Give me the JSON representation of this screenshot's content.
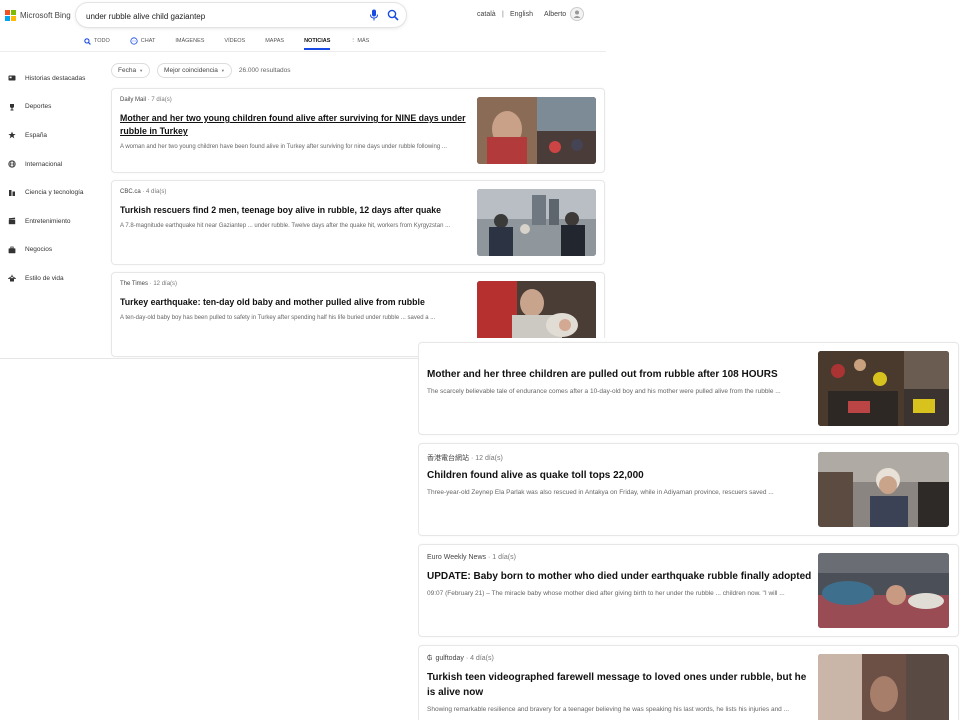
{
  "header": {
    "logo_text": "Microsoft Bing",
    "logo_colors": [
      "#f25022",
      "#7fba00",
      "#00a4ef",
      "#ffb900"
    ],
    "search_value": "under rubble alive child gaziantep",
    "lang_1": "català",
    "separator": "|",
    "lang_2": "English",
    "user_name": "Alberto"
  },
  "tabs": [
    {
      "label": "TODO",
      "icon": "search-icon",
      "active": false
    },
    {
      "label": "CHAT",
      "icon": "chat-icon",
      "active": false
    },
    {
      "label": "IMÁGENES",
      "icon": "",
      "active": false
    },
    {
      "label": "VÍDEOS",
      "icon": "",
      "active": false
    },
    {
      "label": "MAPAS",
      "icon": "",
      "active": false
    },
    {
      "label": "NOTICIAS",
      "icon": "",
      "active": true
    },
    {
      "label": "⋮ MÁS",
      "icon": "",
      "active": false
    }
  ],
  "sidebar": {
    "items": [
      {
        "label": "Historias destacadas",
        "icon": "newspaper-icon"
      },
      {
        "label": "Deportes",
        "icon": "trophy-icon"
      },
      {
        "label": "España",
        "icon": "star-icon"
      },
      {
        "label": "Internacional",
        "icon": "globe-icon"
      },
      {
        "label": "Ciencia y tecnología",
        "icon": "flask-icon"
      },
      {
        "label": "Entretenimiento",
        "icon": "clapper-icon"
      },
      {
        "label": "Negocios",
        "icon": "briefcase-icon"
      },
      {
        "label": "Estilo de vida",
        "icon": "hanger-icon"
      }
    ]
  },
  "filters": {
    "date_label": "Fecha",
    "sort_label": "Mejor coincidencia",
    "results_count": "26.000 resultados"
  },
  "results_top": [
    {
      "source": "Daily Mail",
      "age": " · 7 día(s)",
      "title": "Mother and her two young children found alive after surviving for NINE days under rubble in Turkey",
      "snippet": "A woman and her two young children have been found alive in Turkey after surviving for nine days under rubble following ..."
    },
    {
      "source": "CBC.ca",
      "age": " · 4 día(s)",
      "title": "Turkish rescuers find 2 men, teenage boy alive in rubble, 12 days after quake",
      "snippet": "A 7.8-magnitude earthquake hit near Gaziantep ... under rubble. Twelve days after the quake hit, workers from Kyrgyzstan ..."
    },
    {
      "source": "The Times",
      "age": " · 12 día(s)",
      "title": "Turkey earthquake: ten-day old baby and mother pulled alive from rubble",
      "snippet": "A ten-day-old baby boy has been pulled to safety in Turkey after spending half his life buried under rubble ... saved a ..."
    }
  ],
  "results_bottom": [
    {
      "source": "",
      "age": "",
      "title": "Mother and her three children are pulled out from rubble after 108 HOURS",
      "snippet": "The scarcely believable tale of endurance comes after a 10-day-old boy and his mother were pulled alive from the rubble ..."
    },
    {
      "source": "香港電台網站",
      "age": " · 12 día(s)",
      "title": "Children found alive as quake toll tops 22,000",
      "snippet": "Three-year-old Zeynep Ela Parlak was also rescued in Antakya on Friday, while in Adiyaman province, rescuers saved ..."
    },
    {
      "source": "Euro Weekly News",
      "age": " · 1 día(s)",
      "title": "UPDATE: Baby born to mother who died under earthquake rubble finally adopted",
      "snippet": "09:07 (February 21) – The miracle baby whose mother died after giving birth to her under the rubble ... children now. \"I will ..."
    },
    {
      "source": "gulftoday",
      "age": " · 4 día(s)",
      "title": "Turkish teen videographed farewell message to loved ones under rubble, but he is alive now",
      "snippet": "Showing remarkable resilience and bravery for a teenager believing he was speaking his last words, he lists his injuries and ..."
    }
  ],
  "colors": {
    "accent": "#174ae4",
    "title_text": "#111111",
    "snippet_text": "#666666"
  }
}
